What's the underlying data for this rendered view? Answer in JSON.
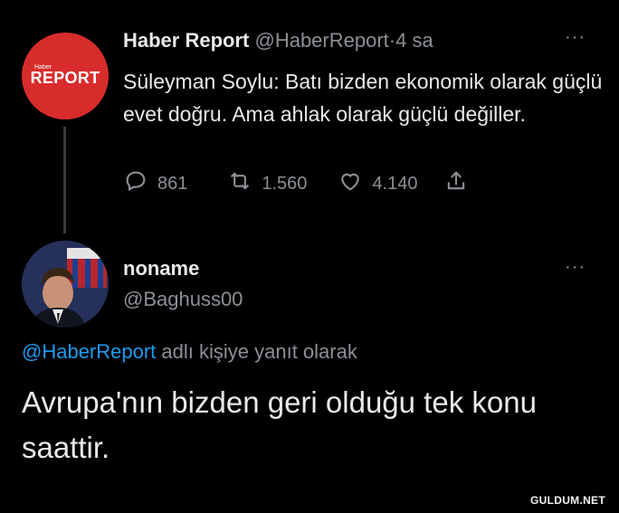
{
  "tweet1": {
    "avatar_small": "Haber",
    "avatar_brand": "REPORT",
    "display_name": "Haber Report",
    "handle": "@HaberReport",
    "separator": "·",
    "time": "4 sa",
    "more": "···",
    "text": "Süleyman Soylu: Batı bizden ekonomik olarak güçlü evet doğru. Ama ahlak olarak güçlü değiller.",
    "actions": {
      "replies": "861",
      "retweets": "1.560",
      "likes": "4.140"
    }
  },
  "tweet2": {
    "display_name": "noname",
    "handle": "@Baghuss00",
    "more": "···",
    "reply_handle": "@HaberReport",
    "reply_suffix": "adlı kişiye yanıt olarak",
    "text": "Avrupa'nın bizden geri olduğu tek konu saattir."
  },
  "watermark": "GULDUM.NET",
  "icons": [
    "reply-icon",
    "retweet-icon",
    "like-icon",
    "share-icon"
  ],
  "colors": {
    "background": "#000000",
    "text": "#e7e9ea",
    "muted": "#8b9096",
    "link": "#1d9bf0",
    "brand_red": "#d82c2c"
  }
}
